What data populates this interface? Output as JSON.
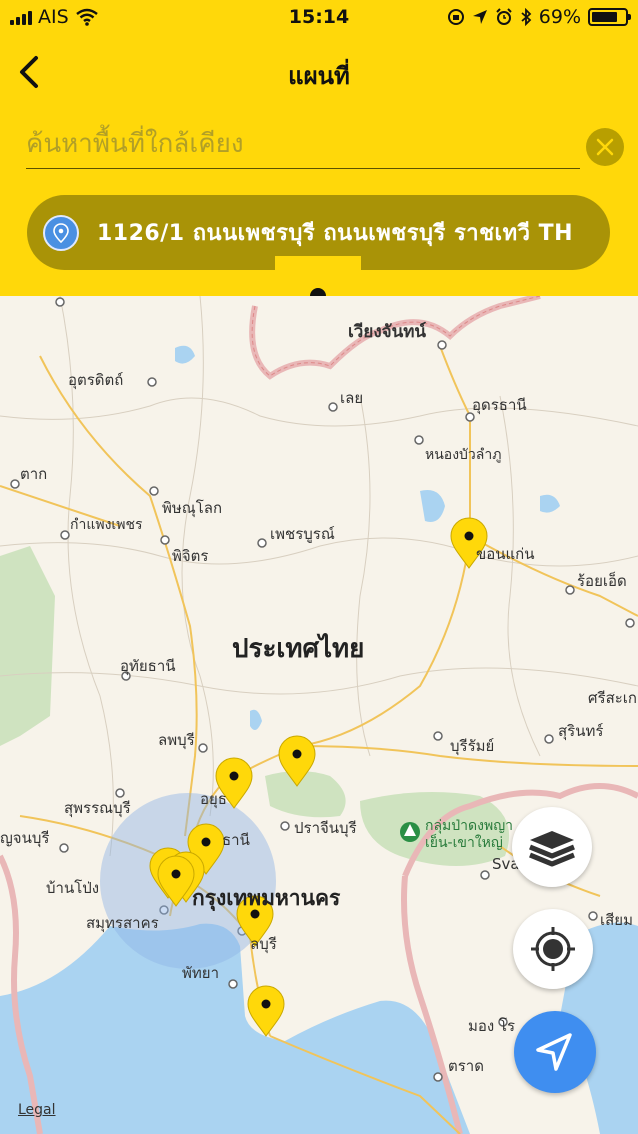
{
  "status_bar": {
    "carrier": "AIS",
    "time": "15:14",
    "battery": "69%",
    "battery_level": 0.69,
    "icons": [
      "signal-icon",
      "wifi-icon",
      "rotation-lock-icon",
      "location-arrow-icon",
      "alarm-icon",
      "bluetooth-icon",
      "battery-icon"
    ]
  },
  "header": {
    "title": "แผนที่",
    "search": {
      "placeholder": "ค้นหาพื้นที่ใกล้เคียง",
      "value": ""
    },
    "address": "1126/1 ถนนเพชรบุรี ถนนเพชรบุรี ราชเทวี TH"
  },
  "map": {
    "country_label": "ประเทศไทย",
    "capital_label": "กรุงเทพมหานคร",
    "park_label": "กลุ่มป่าดงพญาเย็น-เขาใหญ่",
    "places": [
      {
        "name": "เวียงจันทน์",
        "style": "mid-small"
      },
      {
        "name": "อุตรดิตถ์"
      },
      {
        "name": "เลย"
      },
      {
        "name": "อุดรธานี"
      },
      {
        "name": "หนองบัวลำภู"
      },
      {
        "name": "ตาก"
      },
      {
        "name": "พิษณุโลก"
      },
      {
        "name": "กำแพงเพชร"
      },
      {
        "name": "เพชรบูรณ์"
      },
      {
        "name": "พิจิตร"
      },
      {
        "name": "ขอนแก่น"
      },
      {
        "name": "ร้อยเอ็ด"
      },
      {
        "name": "อุทัยธานี"
      },
      {
        "name": "ศรีสะเก"
      },
      {
        "name": "ลพบุรี"
      },
      {
        "name": "บุรีรัมย์"
      },
      {
        "name": "สุรินทร์"
      },
      {
        "name": "สุพรรณบุรี"
      },
      {
        "name": "อยุธ"
      },
      {
        "name": "ปราจีนบุรี"
      },
      {
        "name": "ญจนบุรี"
      },
      {
        "name": "ธานี"
      },
      {
        "name": "บ้านโป่ง"
      },
      {
        "name": "Sva"
      },
      {
        "name": "สมุทรสาคร"
      },
      {
        "name": "ลบุรี"
      },
      {
        "name": "เสียม"
      },
      {
        "name": "พัทยา"
      },
      {
        "name": "มอง โร"
      },
      {
        "name": "ตราด"
      }
    ],
    "legal_link": "Legal"
  },
  "controls": {
    "layers_button": "layers-icon",
    "locate_button": "crosshair-icon",
    "navigate_button": "navigation-arrow-icon"
  },
  "colors": {
    "brand_yellow": "#ffd80a",
    "pill": "#a99307",
    "accent_blue": "#3f8ef0"
  }
}
